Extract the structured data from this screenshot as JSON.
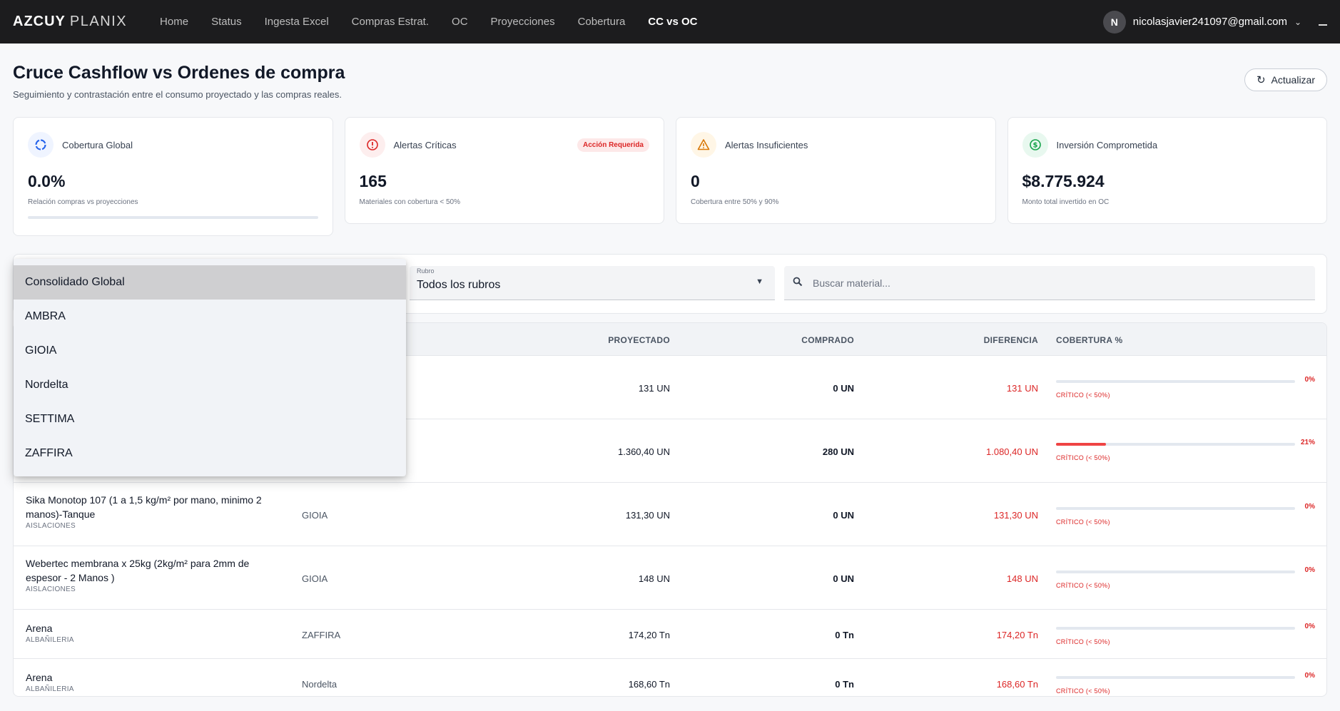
{
  "brand": {
    "bold": "AZCUY",
    "light": "PLANIX"
  },
  "nav": [
    {
      "label": "Home",
      "active": false
    },
    {
      "label": "Status",
      "active": false
    },
    {
      "label": "Ingesta Excel",
      "active": false
    },
    {
      "label": "Compras Estrat.",
      "active": false
    },
    {
      "label": "OC",
      "active": false
    },
    {
      "label": "Proyecciones",
      "active": false
    },
    {
      "label": "Cobertura",
      "active": false
    },
    {
      "label": "CC vs OC",
      "active": true
    }
  ],
  "user": {
    "initial": "N",
    "email": "nicolasjavier241097@gmail.com"
  },
  "page": {
    "title": "Cruce Cashflow vs Ordenes de compra",
    "subtitle": "Seguimiento y contrastación entre el consumo proyectado y las compras reales.",
    "refresh_label": "Actualizar"
  },
  "cards": {
    "coverage": {
      "label": "Cobertura Global",
      "value": "0.0%",
      "note": "Relación compras vs proyecciones",
      "progress": 0
    },
    "critical": {
      "label": "Alertas Críticas",
      "badge": "Acción Requerida",
      "value": "165",
      "note": "Materiales con cobertura < 50%"
    },
    "insufficient": {
      "label": "Alertas Insuficientes",
      "value": "0",
      "note": "Cobertura entre 50% y 90%"
    },
    "investment": {
      "label": "Inversión Comprometida",
      "value": "$8.775.924",
      "note": "Monto total invertido en OC"
    }
  },
  "filters": {
    "rubro_label": "Rubro",
    "rubro_value": "Todos los rubros",
    "search_placeholder": "Buscar material..."
  },
  "dropdown": {
    "options": [
      "Consolidado Global",
      "AMBRA",
      "GIOIA",
      "Nordelta",
      "SETTIMA",
      "ZAFFIRA"
    ],
    "selected": 0
  },
  "table": {
    "headers": {
      "projected": "PROYECTADO",
      "bought": "COMPRADO",
      "difference": "DIFERENCIA",
      "coverage": "COBERTURA %"
    },
    "rows": [
      {
        "material": "",
        "category": "",
        "obra": "",
        "projected": "131 UN",
        "bought": "0 UN",
        "difference": "131 UN",
        "pct": "0%",
        "coverage": 0,
        "status": "CRÍTICO (< 50%)"
      },
      {
        "material": "",
        "category": "",
        "obra": "",
        "projected": "1.360,40 UN",
        "bought": "280 UN",
        "difference": "1.080,40 UN",
        "pct": "21%",
        "coverage": 21,
        "status": "CRÍTICO (< 50%)"
      },
      {
        "material": "Sika Monotop 107 (1 a 1,5 kg/m² por mano, minimo 2 manos)-Tanque",
        "category": "AISLACIONES",
        "obra": "GIOIA",
        "projected": "131,30 UN",
        "bought": "0 UN",
        "difference": "131,30 UN",
        "pct": "0%",
        "coverage": 0,
        "status": "CRÍTICO (< 50%)"
      },
      {
        "material": "Webertec membrana x 25kg (2kg/m² para 2mm de espesor - 2 Manos )",
        "category": "AISLACIONES",
        "obra": "GIOIA",
        "projected": "148 UN",
        "bought": "0 UN",
        "difference": "148 UN",
        "pct": "0%",
        "coverage": 0,
        "status": "CRÍTICO (< 50%)"
      },
      {
        "material": "Arena",
        "category": "ALBAÑILERIA",
        "obra": "ZAFFIRA",
        "projected": "174,20 Tn",
        "bought": "0 Tn",
        "difference": "174,20 Tn",
        "pct": "0%",
        "coverage": 0,
        "status": "CRÍTICO (< 50%)"
      },
      {
        "material": "Arena",
        "category": "ALBAÑILERIA",
        "obra": "Nordelta",
        "projected": "168,60 Tn",
        "bought": "0 Tn",
        "difference": "168,60 Tn",
        "pct": "0%",
        "coverage": 0,
        "status": "CRÍTICO (< 50%)"
      }
    ]
  },
  "colors": {
    "accent": "#2563eb",
    "critical": "#dc2626",
    "warning": "#d97706",
    "success": "#16a34a",
    "topbar": "#1c1c1e"
  }
}
